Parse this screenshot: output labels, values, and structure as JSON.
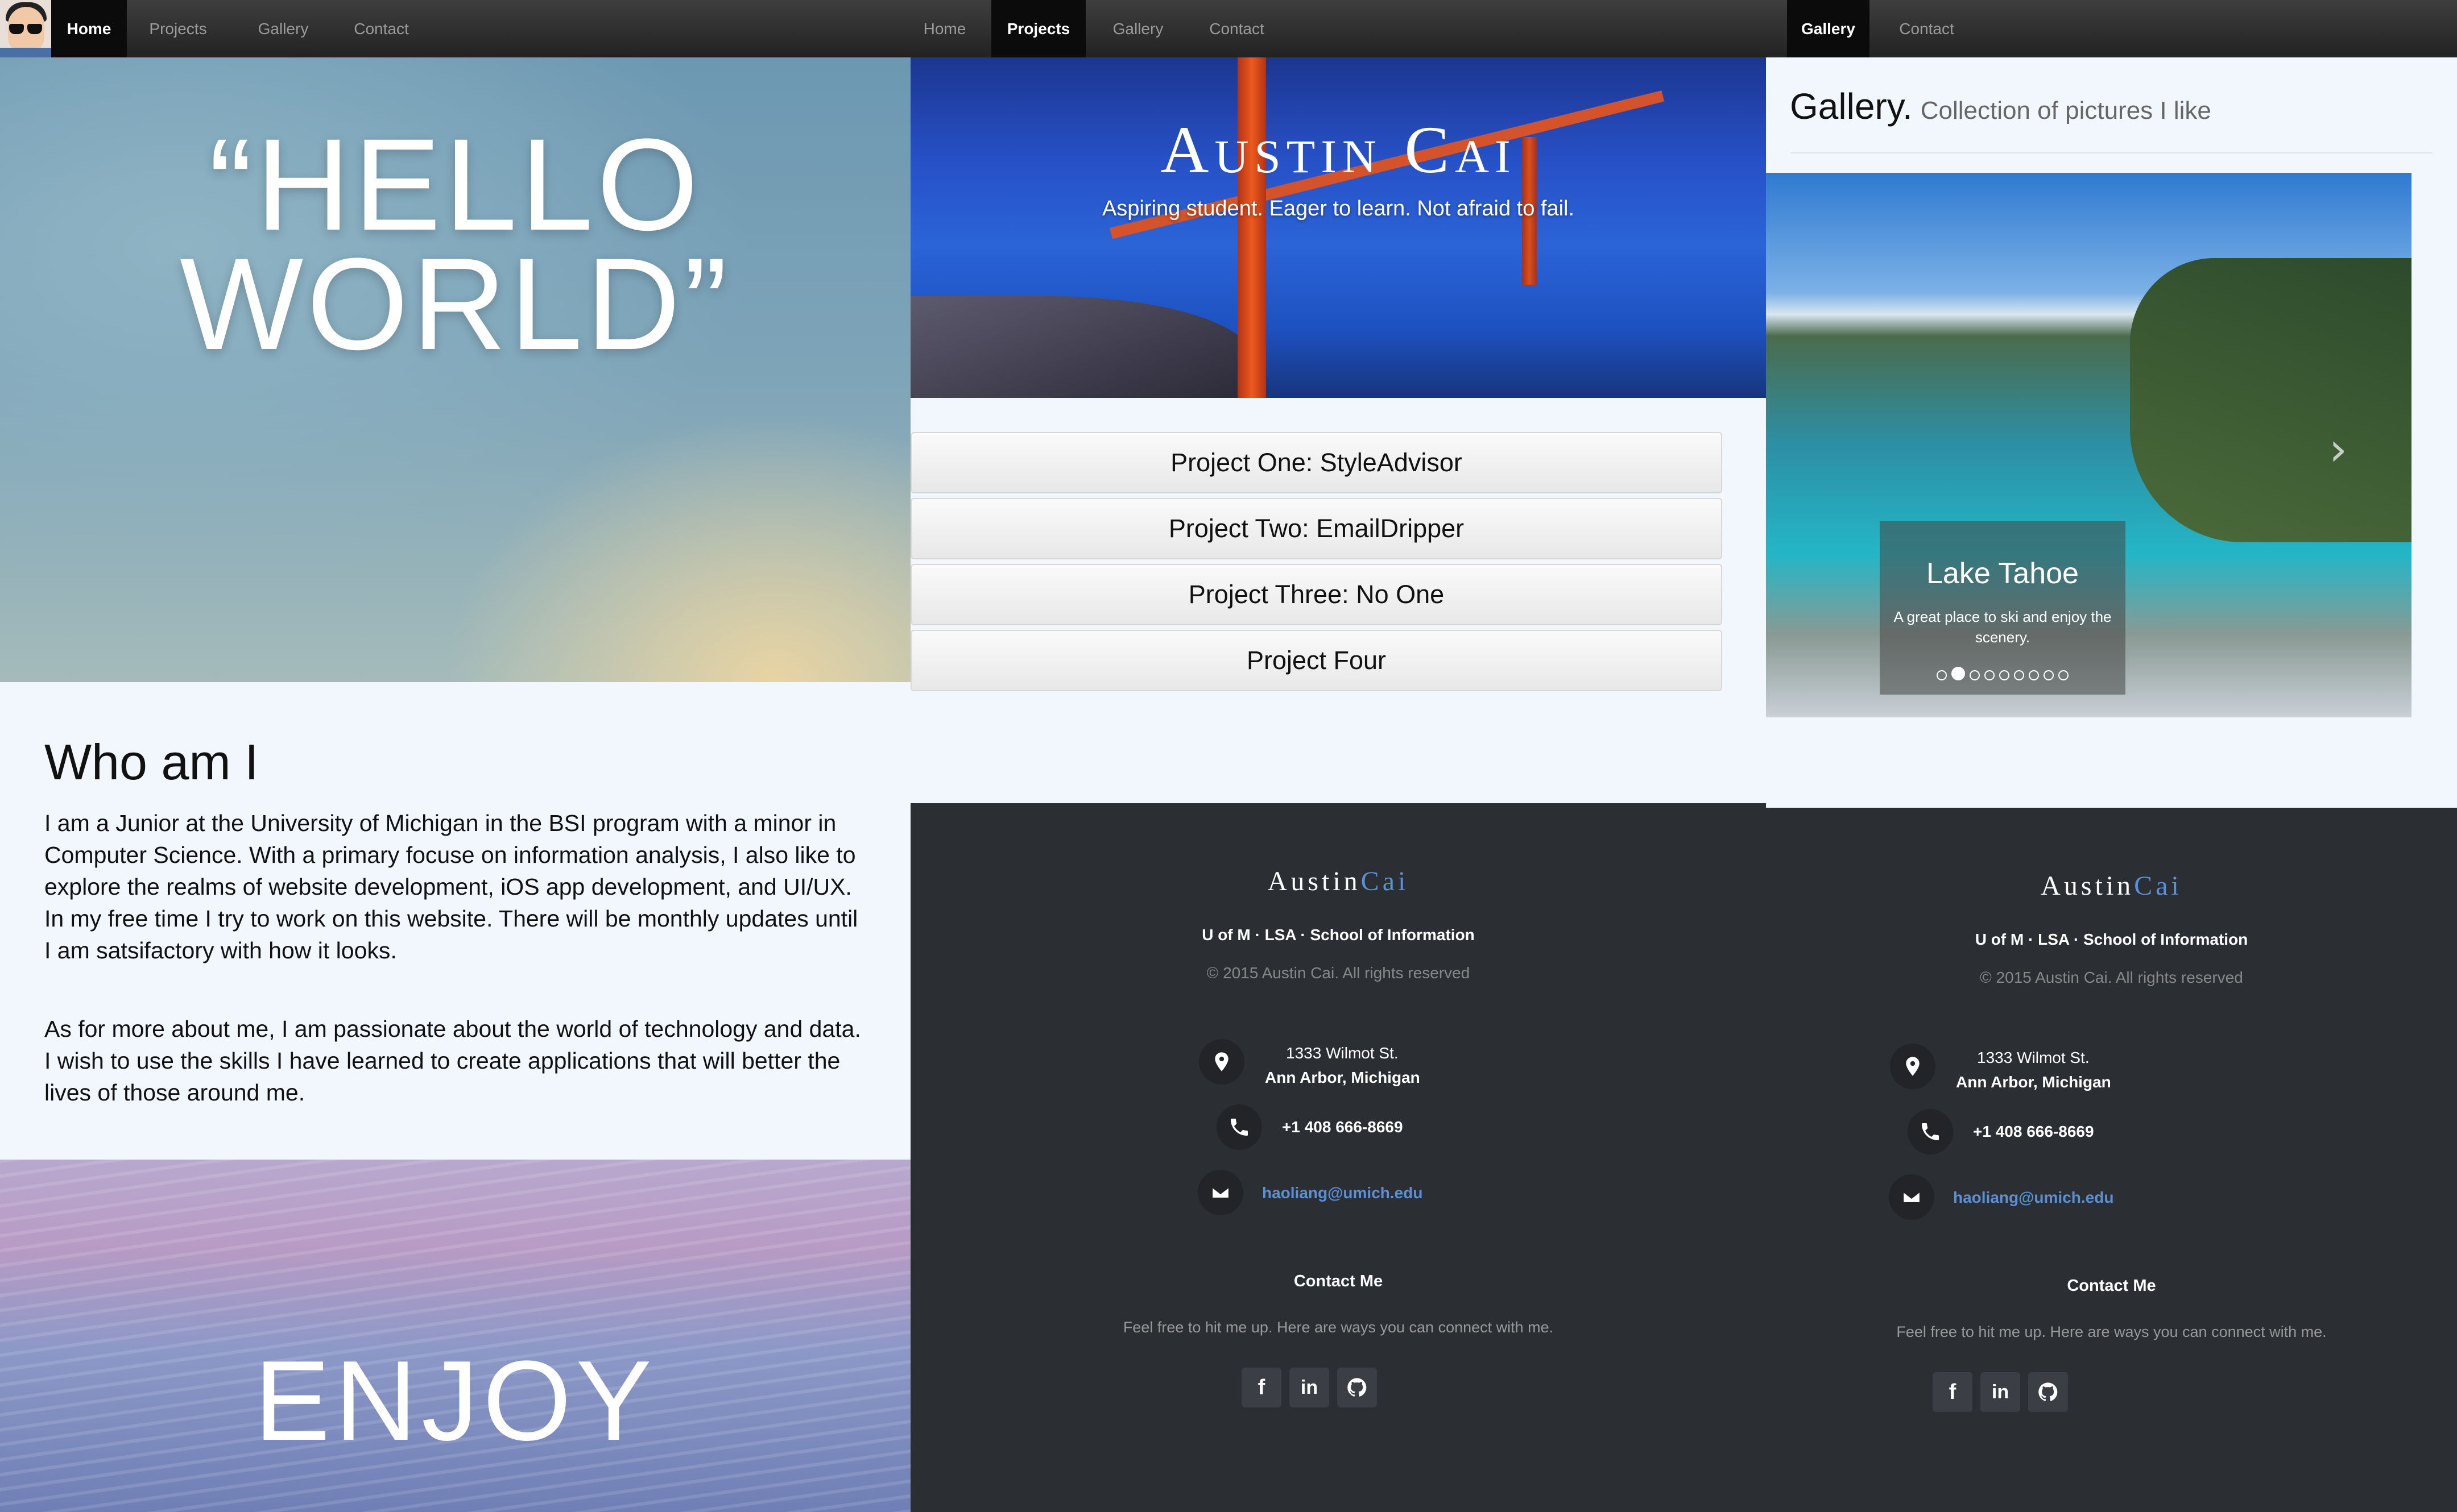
{
  "panel1": {
    "nav": {
      "home": "Home",
      "projects": "Projects",
      "gallery": "Gallery",
      "contact": "Contact"
    },
    "hero_text": "“HELLO\nWORLD”",
    "about_title": "Who am I",
    "about_p1": "I am a Junior at the University of Michigan in the BSI program with a minor in Computer Science. With a primary focuse on information analysis, I also like to explore the realms of website development, iOS app development, and UI/UX. In my free time I try to work on this website. There will be monthly updates until I am satsifactory with how it looks.",
    "about_p2": "As for more about me, I am passionate about the world of technology and data. I wish to use the skills I have learned to create applications that will better the lives of those around me.",
    "enjoy": "ENJOY"
  },
  "panel2": {
    "nav": {
      "home": "Home",
      "projects": "Projects",
      "gallery": "Gallery",
      "contact": "Contact"
    },
    "banner_title": "Austin Cai",
    "banner_sub": "Aspiring student. Eager to learn. Not afraid to fail.",
    "projects": [
      "Project One: StyleAdvisor",
      "Project Two: EmailDripper",
      "Project Three: No One",
      "Project Four"
    ]
  },
  "panel3": {
    "nav": {
      "gallery": "Gallery",
      "contact": "Contact"
    },
    "gallery_title": "Gallery.",
    "gallery_sub": "Collection of pictures I like",
    "caption_title": "Lake Tahoe",
    "caption_text": "A great place to ski and enjoy the scenery.",
    "slide_count": 9,
    "active_slide": 2
  },
  "footer": {
    "brand_a": "Austin",
    "brand_b": "Cai",
    "school": "U of M · LSA · School of Information",
    "copyright": "© 2015 Austin Cai. All rights reserved",
    "address1": "1333 Wilmot St.",
    "address2": "Ann Arbor, Michigan",
    "phone": "+1 408 666-8669",
    "email": "haoliang@umich.edu",
    "contact_title": "Contact Me",
    "contact_desc": "Feel free to hit me up. Here are ways you can connect with me.",
    "social": [
      "facebook-icon",
      "linkedin-icon",
      "github-icon"
    ]
  },
  "colors": {
    "accent": "#5b8fd6",
    "footer_bg": "#2b2e33",
    "page_bg": "#f2f7fe",
    "nav_bg": "#2a2a2a"
  }
}
